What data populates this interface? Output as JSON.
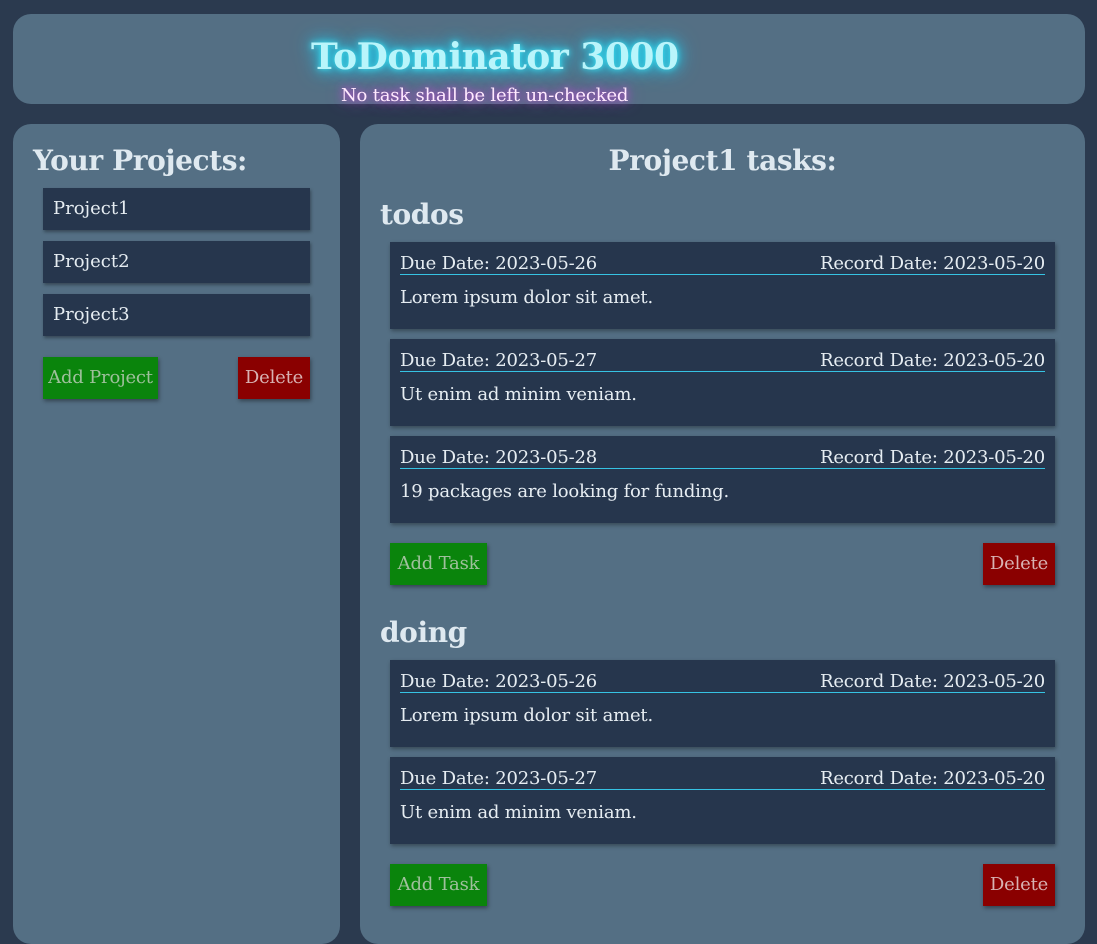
{
  "header": {
    "title": "ToDominator 3000",
    "subtitle": "No task shall be left un-checked"
  },
  "sidebar": {
    "title": "Your Projects:",
    "projects": [
      {
        "label": "Project1"
      },
      {
        "label": "Project2"
      },
      {
        "label": "Project3"
      }
    ],
    "add_label": "Add Project",
    "delete_label": "Delete"
  },
  "main": {
    "title": "Project1 tasks:",
    "sections": [
      {
        "name": "todos",
        "tasks": [
          {
            "due": "Due Date: 2023-05-26",
            "record": "Record Date: 2023-05-20",
            "text": "Lorem ipsum dolor sit amet."
          },
          {
            "due": "Due Date: 2023-05-27",
            "record": "Record Date: 2023-05-20",
            "text": "Ut enim ad minim veniam."
          },
          {
            "due": "Due Date: 2023-05-28",
            "record": "Record Date: 2023-05-20",
            "text": "19 packages are looking for funding."
          }
        ],
        "add_label": "Add Task",
        "delete_label": "Delete"
      },
      {
        "name": "doing",
        "tasks": [
          {
            "due": "Due Date: 2023-05-26",
            "record": "Record Date: 2023-05-20",
            "text": "Lorem ipsum dolor sit amet."
          },
          {
            "due": "Due Date: 2023-05-27",
            "record": "Record Date: 2023-05-20",
            "text": "Ut enim ad minim veniam."
          }
        ],
        "add_label": "Add Task",
        "delete_label": "Delete"
      }
    ]
  },
  "colors": {
    "background": "#2b3a4f",
    "panel": "#546f84",
    "card": "#26364d",
    "add_button": "#0a840c",
    "delete_button": "#8a0000",
    "title_glow": "#3fe6f5",
    "subtitle_glow": "#d24bdf",
    "task_divider": "#36c3e3"
  }
}
